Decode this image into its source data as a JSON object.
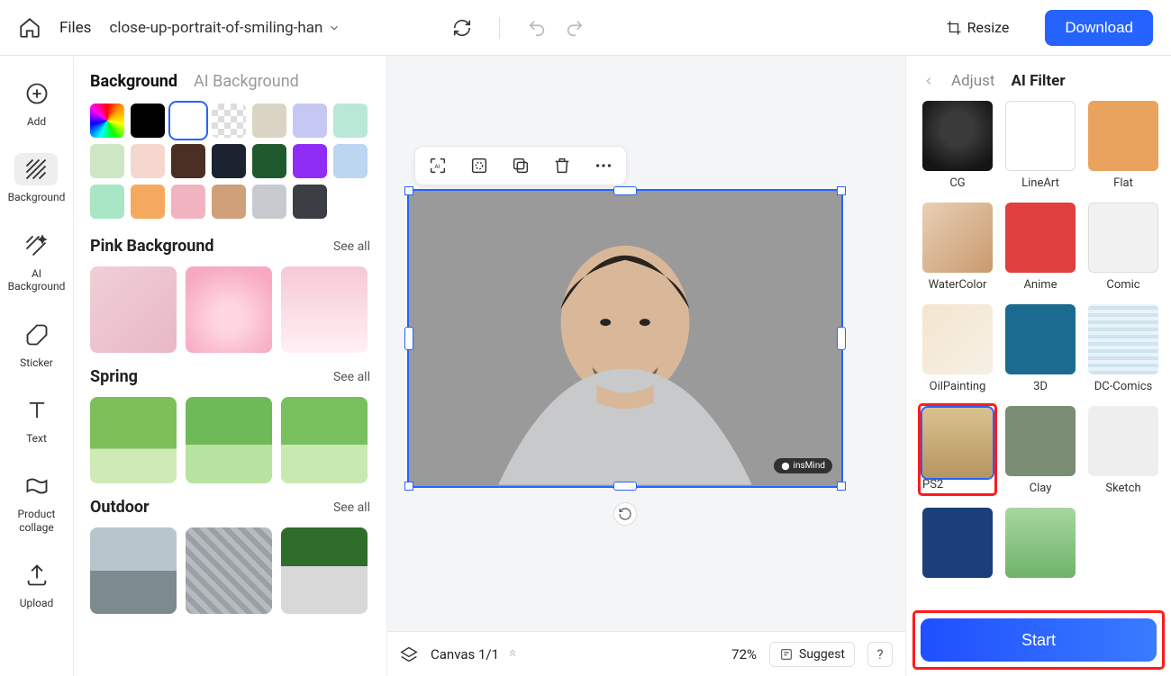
{
  "topbar": {
    "files_label": "Files",
    "filename": "close-up-portrait-of-smiling-han",
    "resize_label": "Resize",
    "download_label": "Download"
  },
  "toolcol": {
    "add": "Add",
    "background": "Background",
    "ai_background": "AI\nBackground",
    "sticker": "Sticker",
    "text": "Text",
    "product_collage": "Product\ncollage",
    "upload": "Upload"
  },
  "bgpanel": {
    "tab_background": "Background",
    "tab_ai_background": "AI Background",
    "swatches": [
      {
        "id": "rainbow",
        "css": "rainbow"
      },
      {
        "id": "black",
        "color": "#000000"
      },
      {
        "id": "white",
        "color": "#ffffff",
        "selected": true
      },
      {
        "id": "transparent",
        "css": "checker"
      },
      {
        "id": "tan",
        "color": "#d9d4c4"
      },
      {
        "id": "lavender",
        "color": "#c6c7f2"
      },
      {
        "id": "mint",
        "color": "#b9e8d6"
      },
      {
        "id": "sage",
        "color": "#cfe6c4"
      },
      {
        "id": "blush",
        "color": "#f6d7d0"
      },
      {
        "id": "brown",
        "color": "#4a2f22"
      },
      {
        "id": "navy",
        "color": "#1b2330"
      },
      {
        "id": "forest",
        "color": "#1f5a2f"
      },
      {
        "id": "violet",
        "color": "#8f2df7"
      },
      {
        "id": "skyblue",
        "color": "#bcd5f0"
      },
      {
        "id": "seafoam",
        "color": "#a8e6c5"
      },
      {
        "id": "orange",
        "color": "#f5a95f"
      },
      {
        "id": "pink",
        "color": "#f2b3c0"
      },
      {
        "id": "bronze",
        "color": "#cfa07a"
      },
      {
        "id": "silver",
        "color": "#c7cbd0"
      },
      {
        "id": "charcoal",
        "color": "#3b3f43"
      }
    ],
    "sections": [
      {
        "title": "Pink Background",
        "seeall": "See all",
        "thumbs": [
          "th-pink1",
          "th-pink2",
          "th-pink3"
        ]
      },
      {
        "title": "Spring",
        "seeall": "See all",
        "thumbs": [
          "th-spr1",
          "th-spr2",
          "th-spr3"
        ]
      },
      {
        "title": "Outdoor",
        "seeall": "See all",
        "thumbs": [
          "th-out1",
          "th-out2",
          "th-out3"
        ]
      }
    ]
  },
  "canvas": {
    "watermark": "insMind",
    "bottom": {
      "canvas_label": "Canvas 1/1",
      "zoom": "72%",
      "suggest": "Suggest",
      "help": "?"
    }
  },
  "rightpanel": {
    "adjust": "Adjust",
    "ai_filter": "AI Filter",
    "start": "Start",
    "filters": [
      {
        "label": "CG",
        "cls": "flt-cg"
      },
      {
        "label": "LineArt",
        "cls": "flt-lineart"
      },
      {
        "label": "Flat",
        "cls": "flt-flat"
      },
      {
        "label": "WaterColor",
        "cls": "flt-water"
      },
      {
        "label": "Anime",
        "cls": "flt-anime"
      },
      {
        "label": "Comic",
        "cls": "flt-comic"
      },
      {
        "label": "OilPainting",
        "cls": "flt-oil"
      },
      {
        "label": "3D",
        "cls": "flt-3d"
      },
      {
        "label": "DC-Comics",
        "cls": "flt-dc"
      },
      {
        "label": "PS2",
        "cls": "flt-ps2",
        "selected": true,
        "highlight": true
      },
      {
        "label": "Clay",
        "cls": "flt-clay"
      },
      {
        "label": "Sketch",
        "cls": "flt-sketch"
      },
      {
        "label": "",
        "cls": "flt-van"
      },
      {
        "label": "",
        "cls": "flt-ghi"
      }
    ]
  }
}
